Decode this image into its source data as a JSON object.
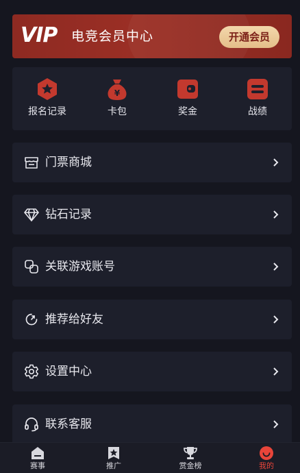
{
  "vip": {
    "mark": "VIP",
    "title": "电竞会员中心",
    "button": "开通会员"
  },
  "quick_actions": [
    {
      "label": "报名记录",
      "icon": "hexagon-star-icon"
    },
    {
      "label": "卡包",
      "icon": "money-bag-icon"
    },
    {
      "label": "奖金",
      "icon": "wallet-icon"
    },
    {
      "label": "战绩",
      "icon": "record-card-icon"
    }
  ],
  "menu": [
    {
      "label": "门票商城",
      "icon": "store-icon"
    },
    {
      "label": "钻石记录",
      "icon": "diamond-icon"
    },
    {
      "label": "关联游戏账号",
      "icon": "link-icon"
    },
    {
      "label": "推荐给好友",
      "icon": "share-refresh-icon"
    },
    {
      "label": "设置中心",
      "icon": "gear-icon"
    },
    {
      "label": "联系客服",
      "icon": "headset-icon"
    }
  ],
  "tabbar": [
    {
      "label": "赛事",
      "icon": "home-icon"
    },
    {
      "label": "推广",
      "icon": "star-flag-icon"
    },
    {
      "label": "赏金榜",
      "icon": "trophy-icon"
    },
    {
      "label": "我的",
      "icon": "smile-face-icon",
      "active": true
    }
  ],
  "colors": {
    "background": "#15161f",
    "card": "#1d1f2b",
    "accent_red": "#c3392e",
    "vip_gold": "#e9c690",
    "active_tab": "#e8453a"
  }
}
